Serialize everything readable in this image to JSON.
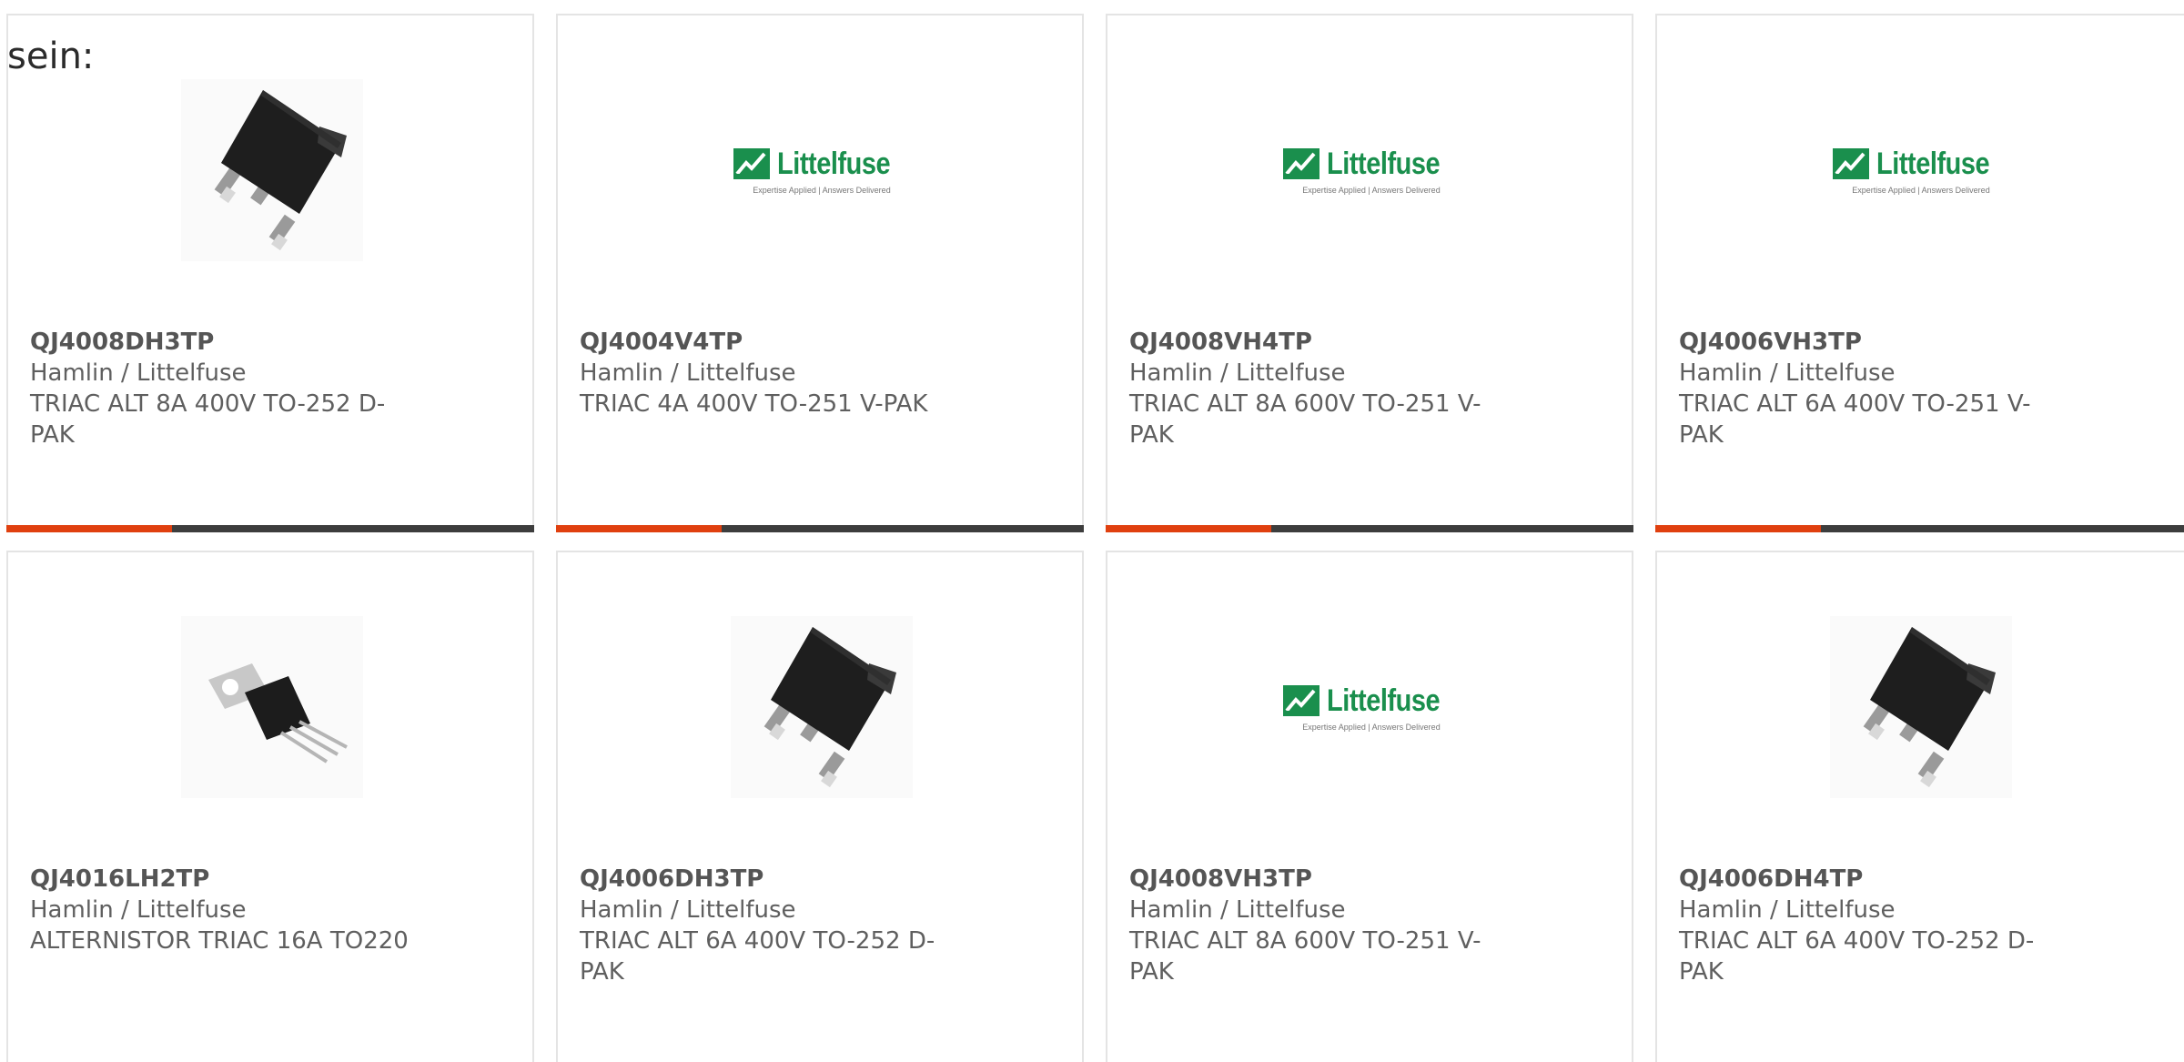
{
  "intro_text": "sein:",
  "colors": {
    "accent": "#e0400f",
    "bar": "#3d3d3d",
    "logo_green": "#1a8f4d"
  },
  "logo": {
    "word": "Littelfuse",
    "tagline": "Expertise Applied | Answers Delivered"
  },
  "products": [
    {
      "part": "QJ4008DH3TP",
      "manufacturer": "Hamlin / Littelfuse",
      "description": "TRIAC ALT 8A 400V TO-252 D-PAK",
      "image": "dpak-package-icon"
    },
    {
      "part": "QJ4004V4TP",
      "manufacturer": "Hamlin / Littelfuse",
      "description": "TRIAC 4A 400V TO-251 V-PAK",
      "image": "littelfuse-logo"
    },
    {
      "part": "QJ4008VH4TP",
      "manufacturer": "Hamlin / Littelfuse",
      "description": "TRIAC ALT 8A 600V TO-251 V-PAK",
      "image": "littelfuse-logo"
    },
    {
      "part": "QJ4006VH3TP",
      "manufacturer": "Hamlin / Littelfuse",
      "description": "TRIAC ALT 6A 400V TO-251 V-PAK",
      "image": "littelfuse-logo"
    },
    {
      "part": "QJ4016LH2TP",
      "manufacturer": "Hamlin / Littelfuse",
      "description": "ALTERNISTOR TRIAC 16A TO220",
      "image": "to220-package-icon"
    },
    {
      "part": "QJ4006DH3TP",
      "manufacturer": "Hamlin / Littelfuse",
      "description": "TRIAC ALT 6A 400V TO-252 D-PAK",
      "image": "dpak-package-icon"
    },
    {
      "part": "QJ4008VH3TP",
      "manufacturer": "Hamlin / Littelfuse",
      "description": "TRIAC ALT 8A 600V TO-251 V-PAK",
      "image": "littelfuse-logo"
    },
    {
      "part": "QJ4006DH4TP",
      "manufacturer": "Hamlin / Littelfuse",
      "description": "TRIAC ALT 6A 400V TO-252 D-PAK",
      "image": "dpak-package-icon"
    }
  ]
}
